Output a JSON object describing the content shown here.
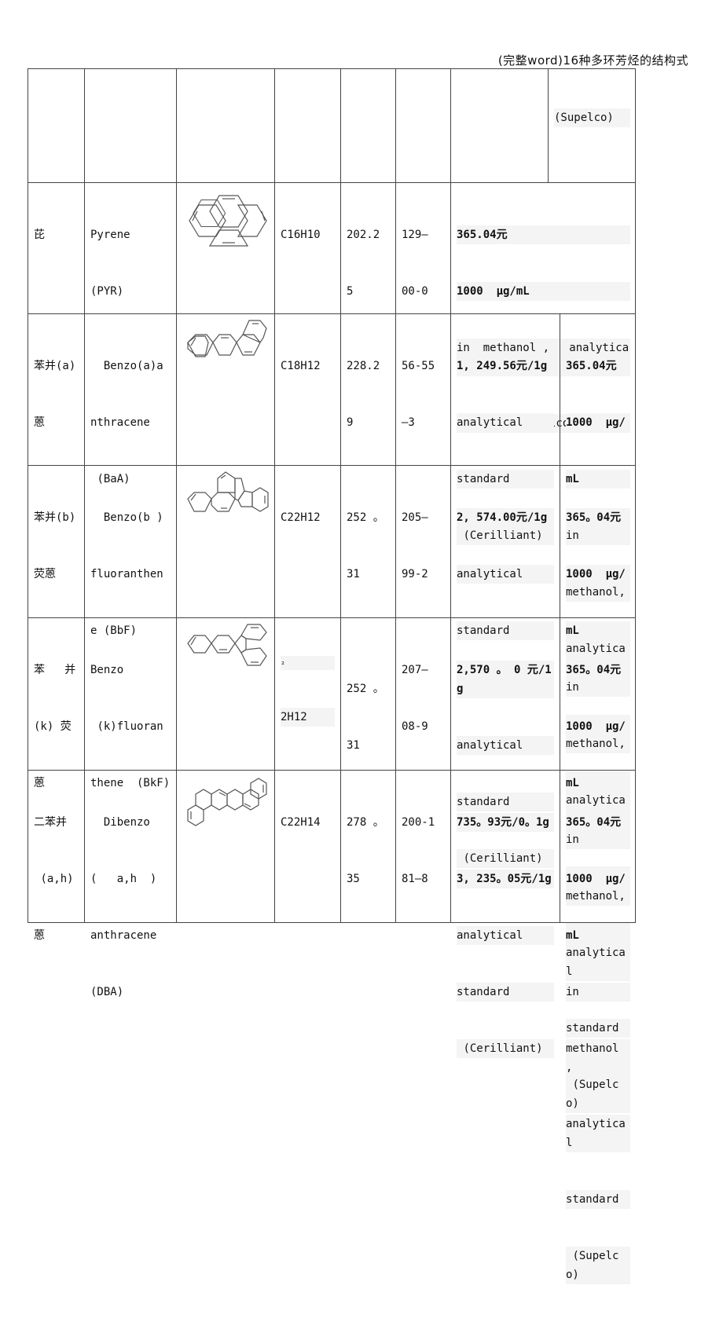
{
  "document": {
    "header_title": "(完整word)16种多环芳烃的结构式"
  },
  "top_row": {
    "col8_text": "(Supelco)"
  },
  "rows": [
    {
      "chinese_name": "芘",
      "english_name": [
        "Pyrene",
        "(PYR)"
      ],
      "structure_icon": "pyrene-structure-icon",
      "formula": "C16H10",
      "mw": [
        "202.2",
        "5"
      ],
      "cas": [
        "129—",
        "00-0"
      ],
      "price": [
        "365.04元",
        "1000  μg/mL",
        "in  methanol ,   analytical",
        "standard (Supelco)"
      ]
    },
    {
      "chinese_name": [
        "苯并(a)",
        "蒽"
      ],
      "english_name": [
        "  Benzo(a)a",
        "nthracene",
        " (BaA)"
      ],
      "structure_icon": "benzo-a-anthracene-structure-icon",
      "formula": "C18H12",
      "mw": [
        "228.2",
        "9"
      ],
      "cas": [
        "56-55",
        "—3"
      ],
      "price_a": [
        "1, 249.56元/1g",
        "analytical",
        "standard",
        " (Cerilliant)"
      ],
      "price_b": [
        "365.04元",
        "1000  μg/",
        "mL",
        "in",
        "methanol,",
        "analytical",
        "standard",
        "(Supelco)"
      ]
    },
    {
      "chinese_name": [
        "苯并(b)",
        "荧蒽"
      ],
      "english_name": [
        "  Benzo(b )",
        "fluoranthen",
        "e (BbF)"
      ],
      "structure_icon": "benzo-b-fluoranthene-structure-icon",
      "formula": "C22H12",
      "mw": [
        "252 。",
        "31"
      ],
      "cas": [
        "205—",
        "99-2"
      ],
      "price_a": [
        "2, 574.00元/1g",
        "analytical",
        "standard",
        "(Cerilliant)"
      ],
      "price_b": [
        "365。04元",
        "1000  μg/",
        "mL",
        "in",
        "methanol,",
        "analytical",
        "standard",
        " (Supelco)"
      ]
    },
    {
      "chinese_name": [
        "苯   并",
        "(k) 荧",
        "蒽"
      ],
      "english_name": [
        "Benzo",
        " (k)fluoran",
        "thene  (BkF)"
      ],
      "structure_icon": "benzo-k-fluoranthene-structure-icon",
      "formula_fragment": "₂",
      "formula": "2H12",
      "mw": [
        "252 。",
        "31"
      ],
      "cas": [
        "207—",
        "08-9"
      ],
      "price_a": [
        "2,570 。 0 元/1g",
        "analytical",
        "standard",
        " (Cerilliant)"
      ],
      "price_b": [
        "365。04元",
        "1000  μg/",
        "mL",
        "in",
        "methanol,",
        "analytical",
        "standard",
        " (Supelco)"
      ]
    },
    {
      "chinese_name": [
        "二苯并",
        " (a,h)",
        "蒽"
      ],
      "english_name": [
        "  Dibenzo",
        "(   a,h  )",
        "anthracene",
        "(DBA)"
      ],
      "structure_icon": "dibenzo-a-h-anthracene-structure-icon",
      "formula": "C22H14",
      "mw": [
        "278 。",
        "35"
      ],
      "cas": [
        "200-1",
        "81—8"
      ],
      "price_a": [
        "735。93元/0。1g",
        "3, 235。05元/1g",
        "analytical",
        "standard",
        " (Cerilliant)"
      ],
      "price_b": [
        "365。04元",
        "1000  μg/",
        "mL",
        "in",
        "methanol ,",
        "analytical",
        "standard",
        " (Supelco)"
      ]
    }
  ]
}
